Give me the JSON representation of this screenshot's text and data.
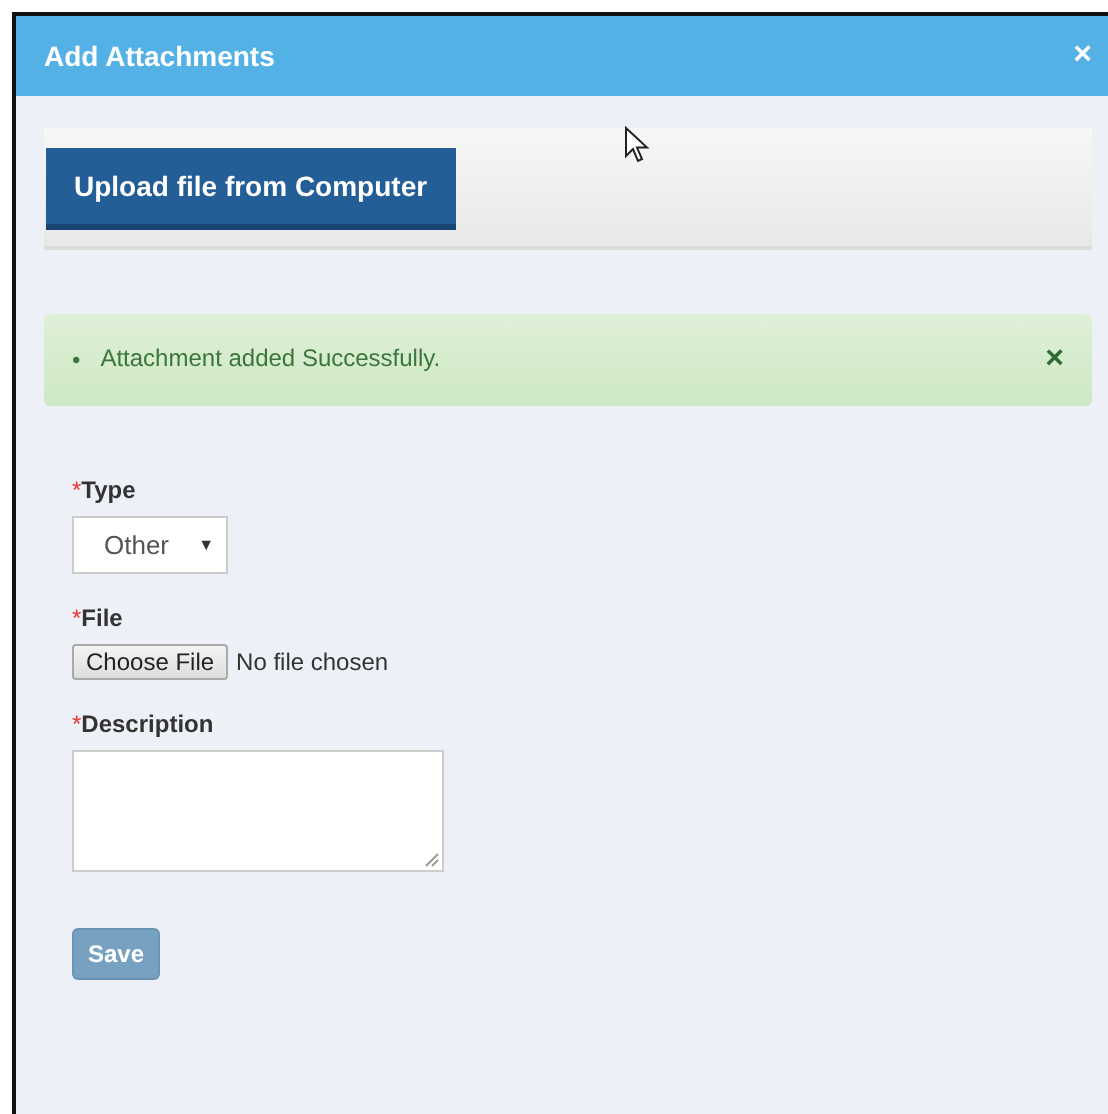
{
  "window": {
    "title": "Add Attachments",
    "close": "×"
  },
  "tabs": [
    {
      "label": "Upload file from Computer",
      "selected": true
    }
  ],
  "alert": {
    "bullet": "•",
    "message": "Attachment added Successfully.",
    "close": "×"
  },
  "fields": [
    {
      "kind": "select",
      "marker": "*",
      "label": "Type",
      "value": "Other",
      "caret": "▼"
    },
    {
      "kind": "file",
      "marker": "*",
      "label": "File",
      "button": "Choose File",
      "status": "No file chosen"
    },
    {
      "kind": "textarea",
      "marker": "*",
      "label": "Description"
    }
  ],
  "save": {
    "label": "Save",
    "disabled": true
  }
}
